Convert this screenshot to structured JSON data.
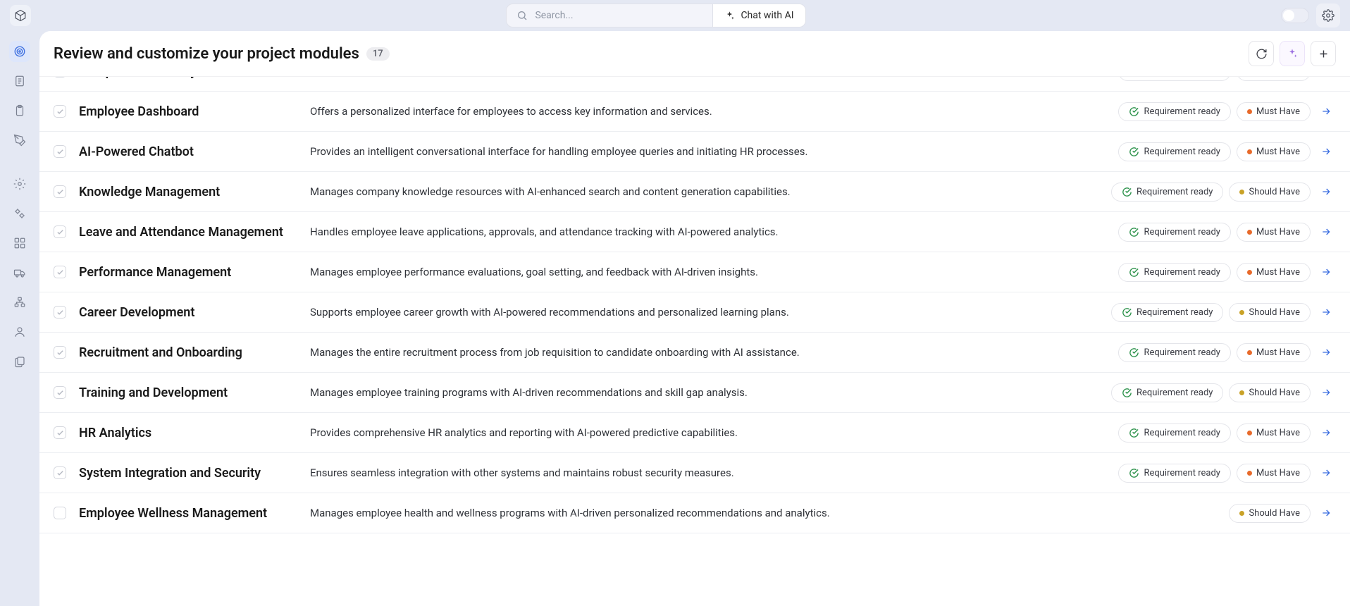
{
  "topbar": {
    "search_placeholder": "Search...",
    "chat_label": "Chat with AI"
  },
  "page": {
    "title": "Review and customize your project modules",
    "count": "17"
  },
  "status_label": "Requirement ready",
  "priority": {
    "must": "Must Have",
    "should": "Should Have"
  },
  "modules": [
    {
      "title": "Compensation Analytics",
      "desc": "…",
      "status": true,
      "priority": "must",
      "checked": true
    },
    {
      "title": "Employee Dashboard",
      "desc": "Offers a personalized interface for employees to access key information and services.",
      "status": true,
      "priority": "must",
      "checked": true
    },
    {
      "title": "AI-Powered Chatbot",
      "desc": "Provides an intelligent conversational interface for handling employee queries and initiating HR processes.",
      "status": true,
      "priority": "must",
      "checked": true
    },
    {
      "title": "Knowledge Management",
      "desc": "Manages company knowledge resources with AI-enhanced search and content generation capabilities.",
      "status": true,
      "priority": "should",
      "checked": true
    },
    {
      "title": "Leave and Attendance Management",
      "desc": "Handles employee leave applications, approvals, and attendance tracking with AI-powered analytics.",
      "status": true,
      "priority": "must",
      "checked": true
    },
    {
      "title": "Performance Management",
      "desc": "Manages employee performance evaluations, goal setting, and feedback with AI-driven insights.",
      "status": true,
      "priority": "must",
      "checked": true
    },
    {
      "title": "Career Development",
      "desc": "Supports employee career growth with AI-powered recommendations and personalized learning plans.",
      "status": true,
      "priority": "should",
      "checked": true
    },
    {
      "title": "Recruitment and Onboarding",
      "desc": "Manages the entire recruitment process from job requisition to candidate onboarding with AI assistance.",
      "status": true,
      "priority": "must",
      "checked": true
    },
    {
      "title": "Training and Development",
      "desc": "Manages employee training programs with AI-driven recommendations and skill gap analysis.",
      "status": true,
      "priority": "should",
      "checked": true
    },
    {
      "title": "HR Analytics",
      "desc": "Provides comprehensive HR analytics and reporting with AI-powered predictive capabilities.",
      "status": true,
      "priority": "must",
      "checked": true
    },
    {
      "title": "System Integration and Security",
      "desc": "Ensures seamless integration with other systems and maintains robust security measures.",
      "status": true,
      "priority": "must",
      "checked": true
    },
    {
      "title": "Employee Wellness Management",
      "desc": "Manages employee health and wellness programs with AI-driven personalized recommendations and analytics.",
      "status": false,
      "priority": "should",
      "checked": false
    }
  ]
}
